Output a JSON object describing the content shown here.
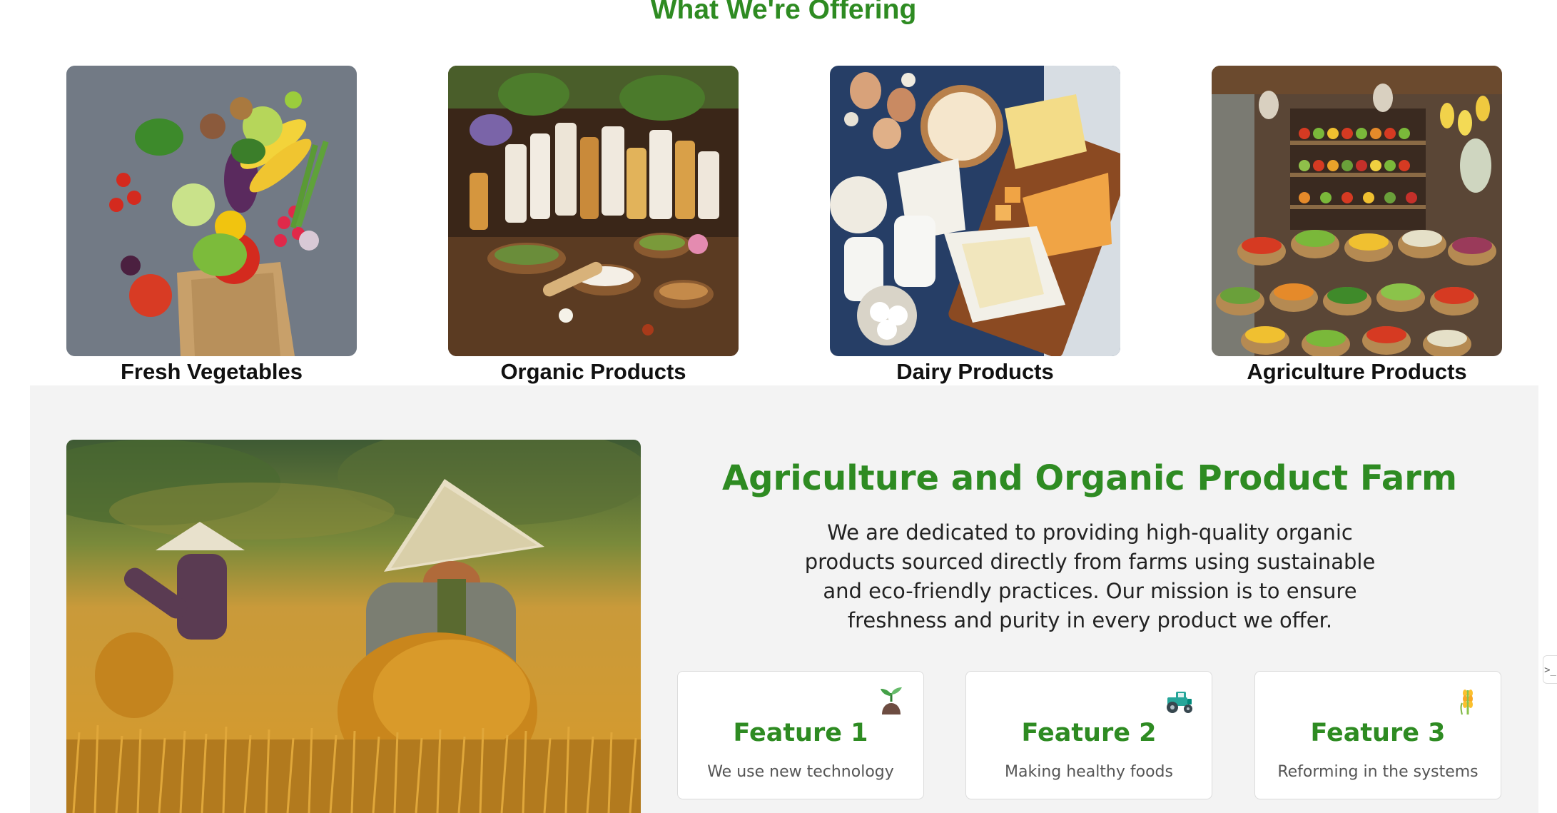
{
  "colors": {
    "accent_green": "#2e8b22",
    "section_bg": "#f3f3f3"
  },
  "offering": {
    "title": "What We're Offering",
    "items": [
      {
        "label": "Fresh Vegetables",
        "image": "fresh-vegetables-photo"
      },
      {
        "label": "Organic Products",
        "image": "organic-products-photo"
      },
      {
        "label": "Dairy Products",
        "image": "dairy-products-photo"
      },
      {
        "label": "Agriculture Products",
        "image": "agriculture-market-photo"
      }
    ]
  },
  "about": {
    "image": "rice-farmers-photo",
    "title": "Agriculture and Organic Product Farm",
    "description": "We are dedicated to providing high-quality organic products sourced directly from farms using sustainable and eco-friendly practices. Our mission is to ensure freshness and purity in every product we offer.",
    "features": [
      {
        "title": "Feature 1",
        "desc": "We use new technology",
        "icon": "seedling-icon"
      },
      {
        "title": "Feature 2",
        "desc": "Making healthy foods",
        "icon": "tractor-icon"
      },
      {
        "title": "Feature 3",
        "desc": "Reforming in the systems",
        "icon": "grain-icon"
      }
    ]
  },
  "side_tab": {
    "icon": "terminal-icon",
    "glyph": ">_"
  }
}
